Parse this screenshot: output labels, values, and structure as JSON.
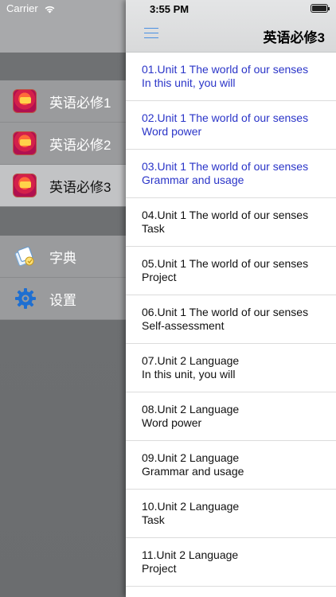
{
  "status": {
    "carrier": "Carrier",
    "time": "3:55 PM"
  },
  "menu": {
    "books": [
      {
        "label": "英语必修1",
        "selected": false
      },
      {
        "label": "英语必修2",
        "selected": false
      },
      {
        "label": "英语必修3",
        "selected": true
      }
    ],
    "tools": [
      {
        "label": "字典",
        "icon": "dictionary-icon"
      },
      {
        "label": "设置",
        "icon": "gear-icon"
      }
    ]
  },
  "header": {
    "title": "英语必修3",
    "menu_icon": "hamburger-icon"
  },
  "lessons": [
    {
      "line1": "01.Unit 1 The world of our senses",
      "line2": "In this unit, you will",
      "visited": true
    },
    {
      "line1": "02.Unit 1 The world of our senses",
      "line2": "Word power",
      "visited": true
    },
    {
      "line1": "03.Unit 1 The world of our senses",
      "line2": "Grammar and usage",
      "visited": true
    },
    {
      "line1": "04.Unit 1 The world of our senses",
      "line2": "Task",
      "visited": false
    },
    {
      "line1": "05.Unit 1 The world of our senses",
      "line2": "Project",
      "visited": false
    },
    {
      "line1": "06.Unit 1 The world of our senses",
      "line2": "Self-assessment",
      "visited": false
    },
    {
      "line1": "07.Unit 2 Language",
      "line2": "In this unit, you will",
      "visited": false
    },
    {
      "line1": "08.Unit 2 Language",
      "line2": "Word power",
      "visited": false
    },
    {
      "line1": "09.Unit 2 Language",
      "line2": "Grammar and usage",
      "visited": false
    },
    {
      "line1": "10.Unit 2 Language",
      "line2": "Task",
      "visited": false
    },
    {
      "line1": "11.Unit 2 Language",
      "line2": "Project",
      "visited": false
    }
  ],
  "colors": {
    "visited_link": "#2a34c8",
    "accent": "#4a90e2"
  }
}
